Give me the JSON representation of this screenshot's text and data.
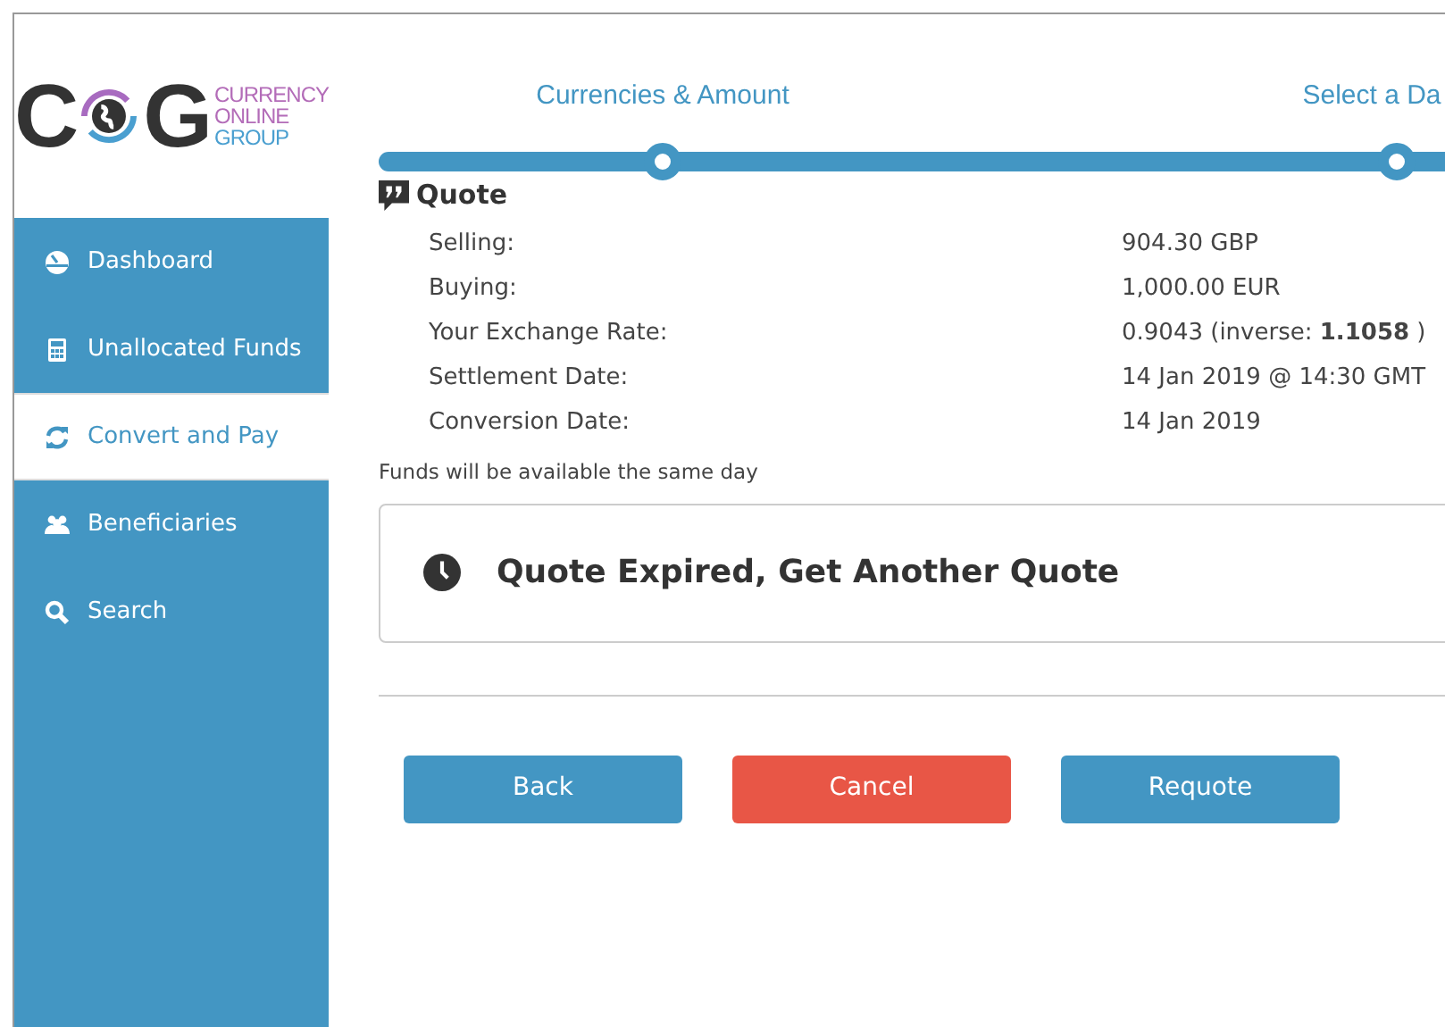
{
  "logo": {
    "letter_left": "C",
    "letter_right": "G",
    "tagline": [
      "CURRENCY",
      "ONLINE",
      "GROUP"
    ]
  },
  "sidebar": {
    "items": [
      {
        "label": "Dashboard",
        "kind": "gauge",
        "selected": false
      },
      {
        "label": "Unallocated Funds",
        "kind": "calculator",
        "selected": false
      },
      {
        "label": "Convert and Pay",
        "kind": "refresh",
        "selected": true
      },
      {
        "label": "Beneficiaries",
        "kind": "people",
        "selected": false
      },
      {
        "label": "Search",
        "kind": "search",
        "selected": false
      }
    ]
  },
  "steps": [
    {
      "label": "Currencies & Amount"
    },
    {
      "label": "Select a Da"
    }
  ],
  "quote": {
    "title": "Quote",
    "rows": [
      {
        "label": "Selling:",
        "value": "904.30 GBP"
      },
      {
        "label": "Buying:",
        "value": "1,000.00 EUR"
      },
      {
        "label": "Your Exchange Rate:",
        "value": "0.9043 (inverse: **1.1058** )"
      },
      {
        "label": "Settlement Date:",
        "value": "14 Jan 2019 @ 14:30 GMT"
      },
      {
        "label": "Conversion Date:",
        "value": "14 Jan 2019"
      }
    ],
    "note": "Funds will be available the same day"
  },
  "alert": {
    "text": "Quote Expired, Get Another Quote"
  },
  "buttons": [
    {
      "label": "Back",
      "kind": "primary"
    },
    {
      "label": "Cancel",
      "kind": "danger"
    },
    {
      "label": "Requote",
      "kind": "primary"
    }
  ]
}
